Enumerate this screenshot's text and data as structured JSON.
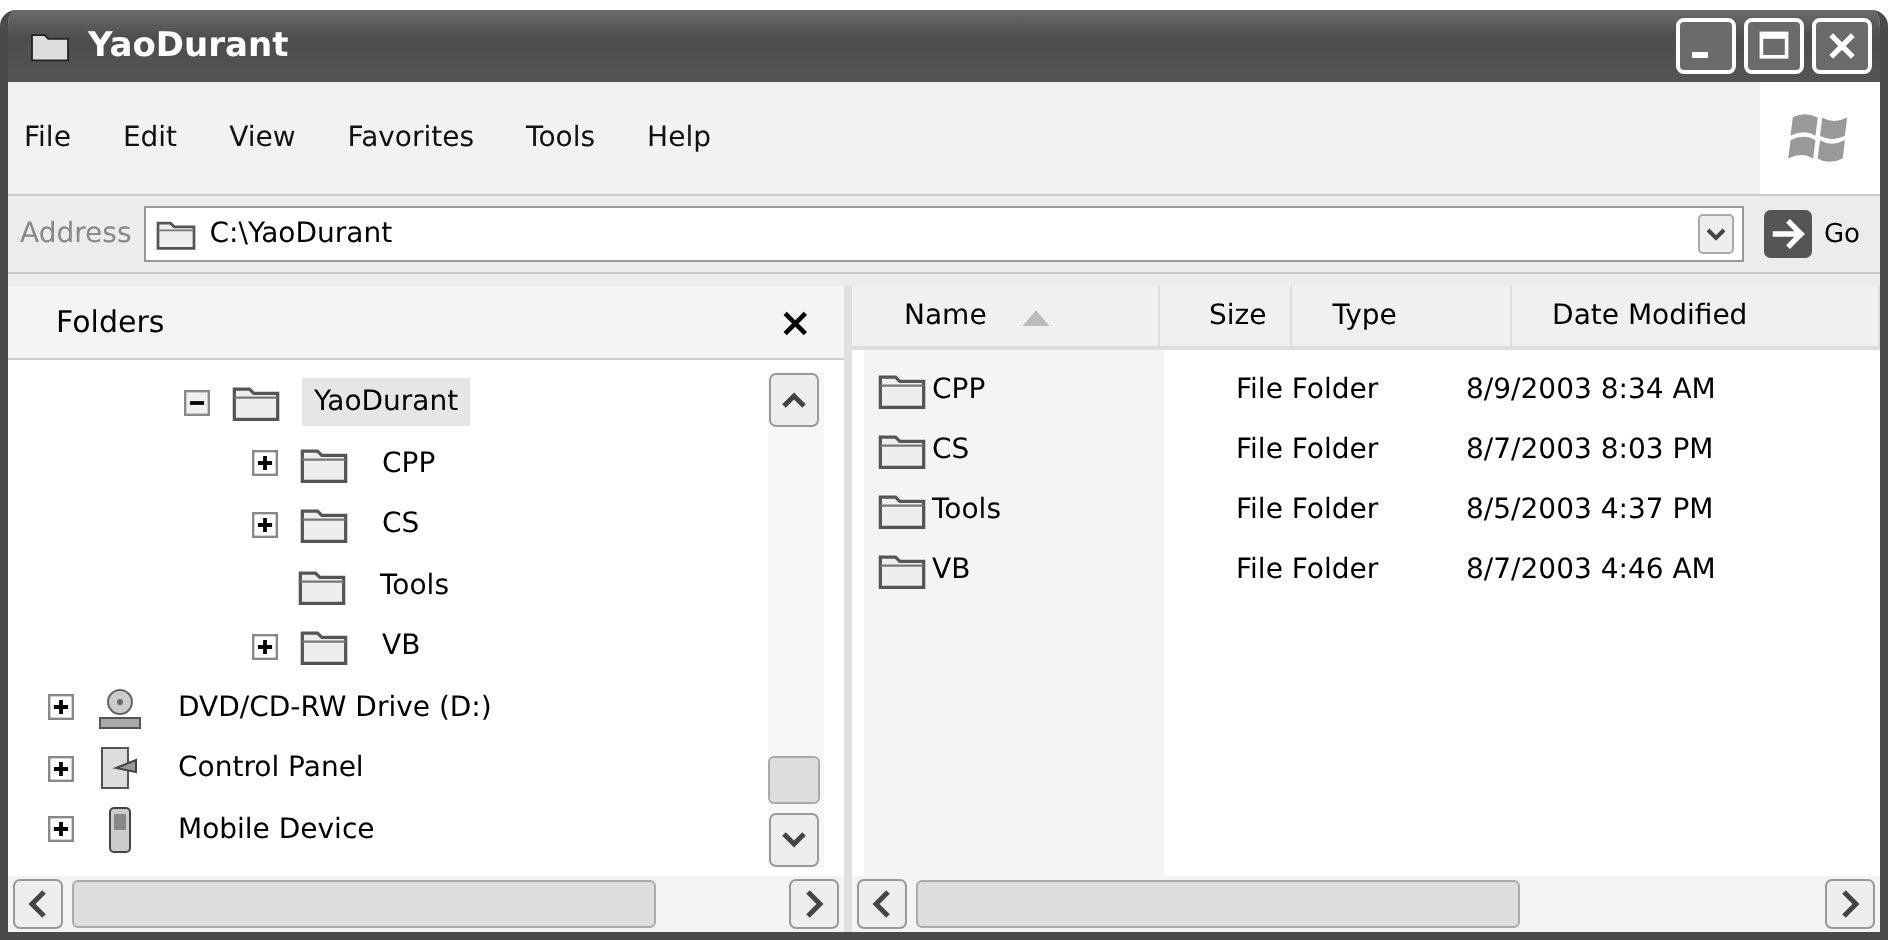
{
  "window": {
    "title": "YaoDurant"
  },
  "menu": [
    "File",
    "Edit",
    "View",
    "Favorites",
    "Tools",
    "Help"
  ],
  "address": {
    "label": "Address",
    "value": "C:\\YaoDurant",
    "go": "Go"
  },
  "folders_pane": {
    "title": "Folders",
    "close": "×",
    "tree": [
      {
        "label": "YaoDurant",
        "kind": "folder",
        "has_children": true,
        "expanded": true,
        "selected": true,
        "children": [
          {
            "label": "CPP",
            "kind": "folder",
            "has_children": true,
            "expanded": false,
            "selected": false
          },
          {
            "label": "CS",
            "kind": "folder",
            "has_children": true,
            "expanded": false,
            "selected": false
          },
          {
            "label": "Tools",
            "kind": "folder",
            "has_children": false,
            "expanded": false,
            "selected": false
          },
          {
            "label": "VB",
            "kind": "folder",
            "has_children": true,
            "expanded": false,
            "selected": false
          }
        ]
      },
      {
        "label": "DVD/CD-RW Drive (D:)",
        "kind": "drive",
        "has_children": true,
        "expanded": false,
        "selected": false
      },
      {
        "label": "Control Panel",
        "kind": "control-panel",
        "has_children": true,
        "expanded": false,
        "selected": false
      },
      {
        "label": "Mobile Device",
        "kind": "device",
        "has_children": true,
        "expanded": false,
        "selected": false
      }
    ]
  },
  "file_list": {
    "columns": [
      {
        "label": "Name",
        "sorted": true
      },
      {
        "label": "Size",
        "sorted": false
      },
      {
        "label": "Type",
        "sorted": false
      },
      {
        "label": "Date Modified",
        "sorted": false
      }
    ],
    "rows": [
      {
        "name": "CPP",
        "type": "File Folder",
        "date_modified": "8/9/2003 8:34 AM"
      },
      {
        "name": "CS",
        "type": "File Folder",
        "date_modified": "8/7/2003 8:03 PM"
      },
      {
        "name": "Tools",
        "type": "File Folder",
        "date_modified": "8/5/2003 4:37 PM"
      },
      {
        "name": "VB",
        "type": "File Folder",
        "date_modified": "8/7/2003 4:46 AM"
      }
    ]
  }
}
